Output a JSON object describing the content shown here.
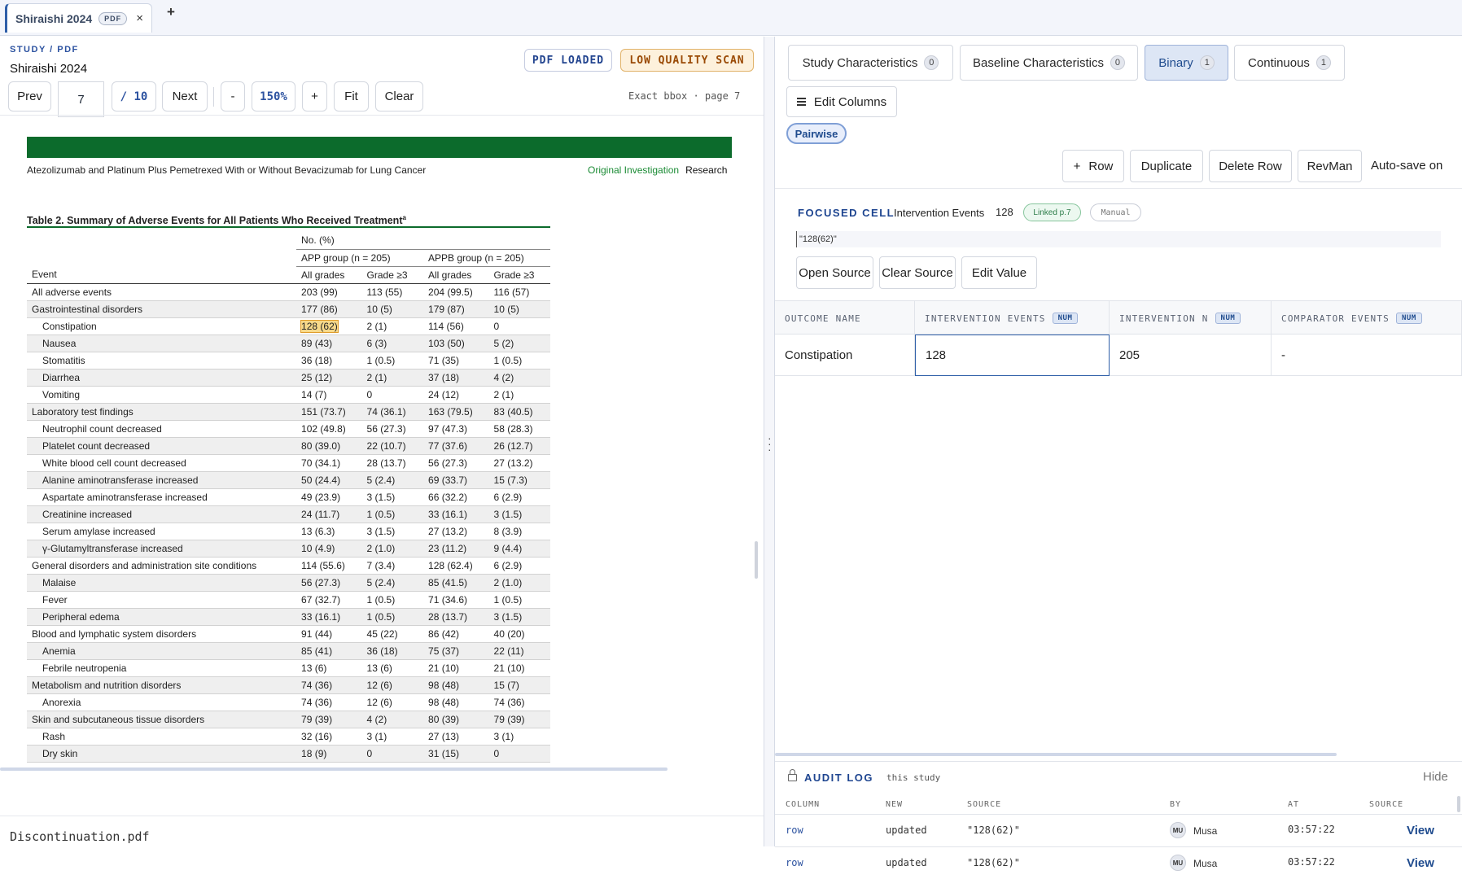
{
  "tabbar": {
    "tab_title": "Shiraishi 2024",
    "tab_badge": "PDF",
    "close_glyph": "×",
    "add_glyph": "+"
  },
  "left": {
    "breadcrumb": "STUDY / PDF",
    "title": "Shiraishi 2024",
    "badge_loaded": "PDF LOADED",
    "badge_quality": "LOW QUALITY SCAN",
    "toolbar": {
      "prev": "Prev",
      "page": "7",
      "total": "/ 10",
      "next": "Next",
      "zoom_out": "-",
      "zoom": "150%",
      "zoom_in": "+",
      "fit": "Fit",
      "clear": "Clear",
      "info": "Exact bbox · page 7"
    },
    "footer_file": "Discontinuation.pdf"
  },
  "pdf": {
    "header_left": "Atezolizumab and Platinum Plus Pemetrexed With or Without Bevacizumab for Lung Cancer",
    "header_original": "Original Investigation",
    "header_research": "Research",
    "table_title": "Table 2. Summary of Adverse Events for All Patients Who Received Treatment",
    "table_title_sup": "a",
    "head": {
      "no_pct": "No. (%)",
      "app": "APP group (n = 205)",
      "appb": "APPB group (n = 205)",
      "event": "Event",
      "all1": "All grades",
      "g31": "Grade ≥3",
      "all2": "All grades",
      "g32": "Grade ≥3"
    },
    "rows": [
      {
        "event": "All adverse events",
        "v": [
          "203 (99)",
          "113 (55)",
          "204 (99.5)",
          "116 (57)"
        ],
        "sub": false,
        "alt": false
      },
      {
        "event": "Gastrointestinal disorders",
        "v": [
          "177 (86)",
          "10 (5)",
          "179 (87)",
          "10 (5)"
        ],
        "sub": false,
        "alt": true
      },
      {
        "event": "Constipation",
        "v": [
          "128 (62)",
          "2 (1)",
          "114 (56)",
          "0"
        ],
        "sub": true,
        "alt": false,
        "hl": true
      },
      {
        "event": "Nausea",
        "v": [
          "89 (43)",
          "6 (3)",
          "103 (50)",
          "5 (2)"
        ],
        "sub": true,
        "alt": true
      },
      {
        "event": "Stomatitis",
        "v": [
          "36 (18)",
          "1 (0.5)",
          "71 (35)",
          "1 (0.5)"
        ],
        "sub": true,
        "alt": false
      },
      {
        "event": "Diarrhea",
        "v": [
          "25 (12)",
          "2 (1)",
          "37 (18)",
          "4 (2)"
        ],
        "sub": true,
        "alt": true
      },
      {
        "event": "Vomiting",
        "v": [
          "14 (7)",
          "0",
          "24 (12)",
          "2 (1)"
        ],
        "sub": true,
        "alt": false
      },
      {
        "event": "Laboratory test findings",
        "v": [
          "151 (73.7)",
          "74 (36.1)",
          "163 (79.5)",
          "83 (40.5)"
        ],
        "sub": false,
        "alt": true
      },
      {
        "event": "Neutrophil count decreased",
        "v": [
          "102 (49.8)",
          "56 (27.3)",
          "97 (47.3)",
          "58 (28.3)"
        ],
        "sub": true,
        "alt": false
      },
      {
        "event": "Platelet count decreased",
        "v": [
          "80 (39.0)",
          "22 (10.7)",
          "77 (37.6)",
          "26 (12.7)"
        ],
        "sub": true,
        "alt": true
      },
      {
        "event": "White blood cell count decreased",
        "v": [
          "70 (34.1)",
          "28 (13.7)",
          "56 (27.3)",
          "27 (13.2)"
        ],
        "sub": true,
        "alt": false
      },
      {
        "event": "Alanine aminotransferase increased",
        "v": [
          "50 (24.4)",
          "5 (2.4)",
          "69 (33.7)",
          "15 (7.3)"
        ],
        "sub": true,
        "alt": true
      },
      {
        "event": "Aspartate aminotransferase increased",
        "v": [
          "49 (23.9)",
          "3 (1.5)",
          "66 (32.2)",
          "6 (2.9)"
        ],
        "sub": true,
        "alt": false
      },
      {
        "event": "Creatinine increased",
        "v": [
          "24 (11.7)",
          "1 (0.5)",
          "33 (16.1)",
          "3 (1.5)"
        ],
        "sub": true,
        "alt": true
      },
      {
        "event": "Serum amylase increased",
        "v": [
          "13 (6.3)",
          "3 (1.5)",
          "27 (13.2)",
          "8 (3.9)"
        ],
        "sub": true,
        "alt": false
      },
      {
        "event": "γ-Glutamyltransferase increased",
        "v": [
          "10 (4.9)",
          "2 (1.0)",
          "23 (11.2)",
          "9 (4.4)"
        ],
        "sub": true,
        "alt": true
      },
      {
        "event": "General disorders and administration site conditions",
        "v": [
          "114 (55.6)",
          "7 (3.4)",
          "128 (62.4)",
          "6 (2.9)"
        ],
        "sub": false,
        "alt": false
      },
      {
        "event": "Malaise",
        "v": [
          "56 (27.3)",
          "5 (2.4)",
          "85 (41.5)",
          "2 (1.0)"
        ],
        "sub": true,
        "alt": true
      },
      {
        "event": "Fever",
        "v": [
          "67 (32.7)",
          "1 (0.5)",
          "71 (34.6)",
          "1 (0.5)"
        ],
        "sub": true,
        "alt": false
      },
      {
        "event": "Peripheral edema",
        "v": [
          "33 (16.1)",
          "1 (0.5)",
          "28 (13.7)",
          "3 (1.5)"
        ],
        "sub": true,
        "alt": true
      },
      {
        "event": "Blood and lymphatic system disorders",
        "v": [
          "91 (44)",
          "45 (22)",
          "86 (42)",
          "40 (20)"
        ],
        "sub": false,
        "alt": false
      },
      {
        "event": "Anemia",
        "v": [
          "85 (41)",
          "36 (18)",
          "75 (37)",
          "22 (11)"
        ],
        "sub": true,
        "alt": true
      },
      {
        "event": "Febrile neutropenia",
        "v": [
          "13 (6)",
          "13 (6)",
          "21 (10)",
          "21 (10)"
        ],
        "sub": true,
        "alt": false
      },
      {
        "event": "Metabolism and nutrition disorders",
        "v": [
          "74 (36)",
          "12 (6)",
          "98 (48)",
          "15 (7)"
        ],
        "sub": false,
        "alt": true
      },
      {
        "event": "Anorexia",
        "v": [
          "74 (36)",
          "12 (6)",
          "98 (48)",
          "74 (36)"
        ],
        "sub": true,
        "alt": false
      },
      {
        "event": "Skin and subcutaneous tissue disorders",
        "v": [
          "79 (39)",
          "4 (2)",
          "80 (39)",
          "79 (39)"
        ],
        "sub": false,
        "alt": true
      },
      {
        "event": "Rash",
        "v": [
          "32 (16)",
          "3 (1)",
          "27 (13)",
          "3 (1)"
        ],
        "sub": true,
        "alt": false
      },
      {
        "event": "Dry skin",
        "v": [
          "18 (9)",
          "0",
          "31 (15)",
          "0"
        ],
        "sub": true,
        "alt": true
      }
    ]
  },
  "right": {
    "tabs": [
      {
        "label": "Study Characteristics",
        "count": "0"
      },
      {
        "label": "Baseline Characteristics",
        "count": "0"
      },
      {
        "label": "Binary",
        "count": "1"
      },
      {
        "label": "Continuous",
        "count": "1"
      }
    ],
    "edit_columns": "Edit Columns",
    "pill": "Pairwise",
    "actions": {
      "row": "Row",
      "duplicate": "Duplicate",
      "delete_row": "Delete Row",
      "revman": "RevMan",
      "autosave": "Auto-save on"
    },
    "focused": {
      "label": "FOCUSED CELL",
      "field": "Intervention Events",
      "value": "128",
      "linked": "Linked p.7",
      "manual": "Manual",
      "source": "\"128(62)\"",
      "open_source": "Open Source",
      "clear_source": "Clear Source",
      "edit_value": "Edit Value"
    },
    "grid": {
      "headers": [
        "OUTCOME NAME",
        "INTERVENTION EVENTS",
        "INTERVENTION N",
        "COMPARATOR EVENTS"
      ],
      "num_tag": "NUM",
      "row": [
        "Constipation",
        "128",
        "205",
        "-"
      ]
    },
    "audit": {
      "title": "AUDIT LOG",
      "scope": "this study",
      "hide": "Hide",
      "headers": [
        "COLUMN",
        "NEW",
        "SOURCE",
        "BY",
        "AT",
        "SOURCE"
      ],
      "rows": [
        {
          "column": "row",
          "new": "updated",
          "source": "\"128(62)\"",
          "initials": "MU",
          "by": "Musa",
          "at": "03:57:22",
          "view": "View"
        },
        {
          "column": "row",
          "new": "updated",
          "source": "\"128(62)\"",
          "initials": "MU",
          "by": "Musa",
          "at": "03:57:22",
          "view": "View"
        }
      ]
    }
  }
}
